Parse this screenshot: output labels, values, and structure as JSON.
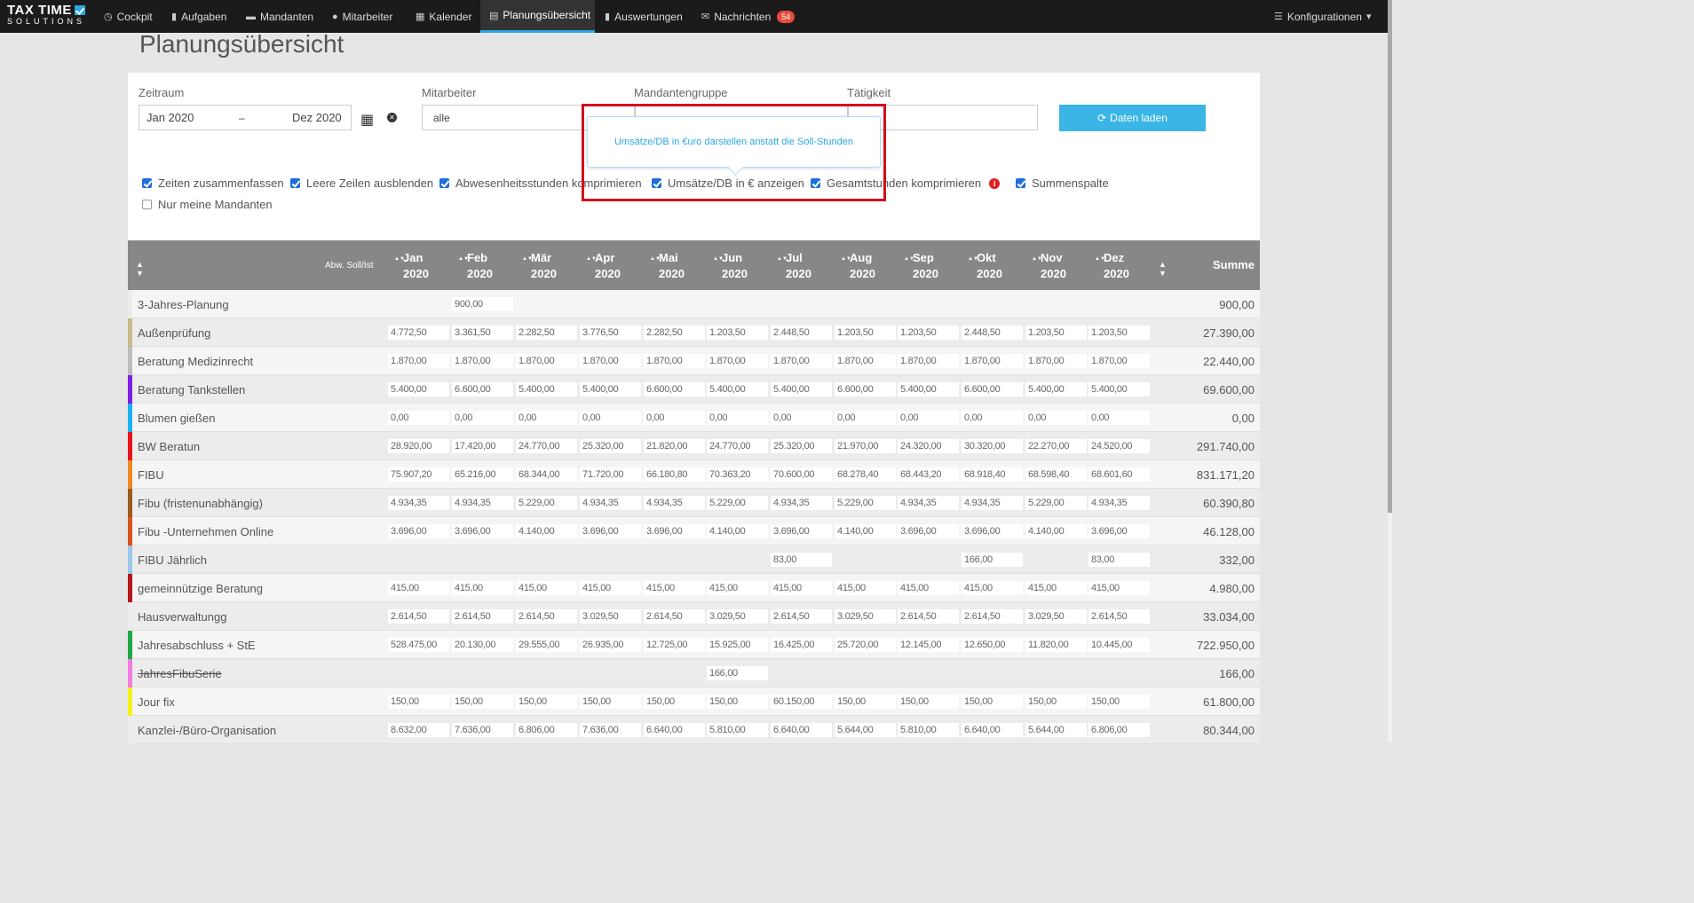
{
  "nav": {
    "logo_line1": "TAX TIME",
    "logo_line2": "SOLUTIONS",
    "items": [
      {
        "label": "Cockpit",
        "icon": "dashboard-icon",
        "glyph": "◷"
      },
      {
        "label": "Aufgaben",
        "icon": "bookmark-icon",
        "glyph": "▮"
      },
      {
        "label": "Mandanten",
        "icon": "folder-icon",
        "glyph": "▬"
      },
      {
        "label": "Mitarbeiter",
        "icon": "users-icon",
        "glyph": "●"
      },
      {
        "label": "Kalender",
        "icon": "calendar-icon",
        "glyph": "▦"
      },
      {
        "label": "Planungsübersicht",
        "icon": "list-icon",
        "glyph": "▤"
      },
      {
        "label": "Auswertungen",
        "icon": "bar-chart-icon",
        "glyph": "▮"
      },
      {
        "label": "Nachrichten",
        "icon": "envelope-icon",
        "glyph": "✉",
        "badge": "54"
      }
    ],
    "config_label": "Konfigurationen"
  },
  "page_title": "Planungsübersicht",
  "filters": {
    "zeitraum_label": "Zeitraum",
    "zeitraum_from": "Jan 2020",
    "zeitraum_sep": "–",
    "zeitraum_to": "Dez 2020",
    "mitarbeiter_label": "Mitarbeiter",
    "mitarbeiter_value": "alle",
    "mandantengruppe_label": "Mandantengruppe",
    "taetigkeit_label": "Tätigkeit",
    "load_button": "Daten laden"
  },
  "checkboxes": [
    {
      "label": "Zeiten zusammenfassen",
      "checked": true
    },
    {
      "label": "Leere Zeilen ausblenden",
      "checked": true
    },
    {
      "label": "Abwesenheitsstunden komprimieren",
      "checked": true
    },
    {
      "label": "Umsätze/DB in € anzeigen",
      "checked": true
    },
    {
      "label": "Gesamtstunden komprimieren",
      "checked": true
    },
    {
      "label": "Summenspalte",
      "checked": true
    },
    {
      "label": "Nur meine Mandanten",
      "checked": false
    }
  ],
  "tooltip": "Umsätze/DB in €uro darstellen anstatt die Soll-Stunden",
  "table": {
    "abw_header": "Abw. Soll/Ist",
    "summe_header": "Summe",
    "months": [
      {
        "m": "Jan",
        "y": "2020"
      },
      {
        "m": "Feb",
        "y": "2020"
      },
      {
        "m": "Mär",
        "y": "2020"
      },
      {
        "m": "Apr",
        "y": "2020"
      },
      {
        "m": "Mai",
        "y": "2020"
      },
      {
        "m": "Jun",
        "y": "2020"
      },
      {
        "m": "Jul",
        "y": "2020"
      },
      {
        "m": "Aug",
        "y": "2020"
      },
      {
        "m": "Sep",
        "y": "2020"
      },
      {
        "m": "Okt",
        "y": "2020"
      },
      {
        "m": "Nov",
        "y": "2020"
      },
      {
        "m": "Dez",
        "y": "2020"
      }
    ],
    "rows": [
      {
        "name": "3-Jahres-Planung",
        "color": "#ececec",
        "values": [
          "",
          "900,00",
          "",
          "",
          "",
          "",
          "",
          "",
          "",
          "",
          "",
          ""
        ],
        "sum": "900,00"
      },
      {
        "name": "Außenprüfung",
        "color": "#c8b88a",
        "values": [
          "4.772,50",
          "3.361,50",
          "2.282,50",
          "3.776,50",
          "2.282,50",
          "1.203,50",
          "2.448,50",
          "1.203,50",
          "1.203,50",
          "2.448,50",
          "1.203,50",
          "1.203,50"
        ],
        "sum": "27.390,00"
      },
      {
        "name": "Beratung Medizinrecht",
        "color": "#bdbdbd",
        "values": [
          "1.870,00",
          "1.870,00",
          "1.870,00",
          "1.870,00",
          "1.870,00",
          "1.870,00",
          "1.870,00",
          "1.870,00",
          "1.870,00",
          "1.870,00",
          "1.870,00",
          "1.870,00"
        ],
        "sum": "22.440,00"
      },
      {
        "name": "Beratung Tankstellen",
        "color": "#7b1fe0",
        "values": [
          "5.400,00",
          "6.600,00",
          "5.400,00",
          "5.400,00",
          "6.600,00",
          "5.400,00",
          "5.400,00",
          "6.600,00",
          "5.400,00",
          "6.600,00",
          "5.400,00",
          "5.400,00"
        ],
        "sum": "69.600,00"
      },
      {
        "name": "Blumen gießen",
        "color": "#1ab3f0",
        "values": [
          "0,00",
          "0,00",
          "0,00",
          "0,00",
          "0,00",
          "0,00",
          "0,00",
          "0,00",
          "0,00",
          "0,00",
          "0,00",
          "0,00"
        ],
        "sum": "0,00"
      },
      {
        "name": "BW Beratun",
        "color": "#e8141c",
        "values": [
          "28.920,00",
          "17.420,00",
          "24.770,00",
          "25.320,00",
          "21.820,00",
          "24.770,00",
          "25.320,00",
          "21.970,00",
          "24.320,00",
          "30.320,00",
          "22.270,00",
          "24.520,00"
        ],
        "sum": "291.740,00"
      },
      {
        "name": "FIBU",
        "color": "#f08a24",
        "values": [
          "75.907,20",
          "65.216,00",
          "68.344,00",
          "71.720,00",
          "66.180,80",
          "70.363,20",
          "70.600,00",
          "68.278,40",
          "68.443,20",
          "68.918,40",
          "68.598,40",
          "68.601,60"
        ],
        "sum": "831.171,20"
      },
      {
        "name": "Fibu (fristenunabhängig)",
        "color": "#9a5a1e",
        "values": [
          "4.934,35",
          "4.934,35",
          "5.229,00",
          "4.934,35",
          "4.934,35",
          "5.229,00",
          "4.934,35",
          "5.229,00",
          "4.934,35",
          "4.934,35",
          "5.229,00",
          "4.934,35"
        ],
        "sum": "60.390,80"
      },
      {
        "name": "Fibu -Unternehmen Online",
        "color": "#d9531e",
        "values": [
          "3.696,00",
          "3.696,00",
          "4.140,00",
          "3.696,00",
          "3.696,00",
          "4.140,00",
          "3.696,00",
          "4.140,00",
          "3.696,00",
          "3.696,00",
          "4.140,00",
          "3.696,00"
        ],
        "sum": "46.128,00"
      },
      {
        "name": "FIBU Jährlich",
        "color": "#9cc8ea",
        "values": [
          "",
          "",
          "",
          "",
          "",
          "",
          "83,00",
          "",
          "",
          "166,00",
          "",
          "83,00"
        ],
        "sum": "332,00"
      },
      {
        "name": "gemeinnützige Beratung",
        "color": "#b3171c",
        "values": [
          "415,00",
          "415,00",
          "415,00",
          "415,00",
          "415,00",
          "415,00",
          "415,00",
          "415,00",
          "415,00",
          "415,00",
          "415,00",
          "415,00"
        ],
        "sum": "4.980,00"
      },
      {
        "name": "Hausverwaltungg",
        "color": "#ececec",
        "values": [
          "2.614,50",
          "2.614,50",
          "2.614,50",
          "3.029,50",
          "2.614,50",
          "3.029,50",
          "2.614,50",
          "3.029,50",
          "2.614,50",
          "2.614,50",
          "3.029,50",
          "2.614,50"
        ],
        "sum": "33.034,00"
      },
      {
        "name": "Jahresabschluss + StE",
        "color": "#1ea84a",
        "values": [
          "528.475,00",
          "20.130,00",
          "29.555,00",
          "26.935,00",
          "12.725,00",
          "15.925,00",
          "16.425,00",
          "25.720,00",
          "12.145,00",
          "12.650,00",
          "11.820,00",
          "10.445,00"
        ],
        "sum": "722.950,00"
      },
      {
        "name": "JahresFibuSerie",
        "color": "#f27ae0",
        "strike": true,
        "values": [
          "",
          "",
          "",
          "",
          "",
          "166,00",
          "",
          "",
          "",
          "",
          "",
          ""
        ],
        "sum": "166,00"
      },
      {
        "name": "Jour fix",
        "color": "#f5f01a",
        "values": [
          "150,00",
          "150,00",
          "150,00",
          "150,00",
          "150,00",
          "150,00",
          "60.150,00",
          "150,00",
          "150,00",
          "150,00",
          "150,00",
          "150,00"
        ],
        "sum": "61.800,00"
      },
      {
        "name": "Kanzlei-/Büro-Organisation",
        "color": "#ececec",
        "values": [
          "8.632,00",
          "7.636,00",
          "6.806,00",
          "7.636,00",
          "6.640,00",
          "5.810,00",
          "6.640,00",
          "5.644,00",
          "5.810,00",
          "6.640,00",
          "5.644,00",
          "6.806,00"
        ],
        "sum": "80.344,00"
      }
    ]
  }
}
